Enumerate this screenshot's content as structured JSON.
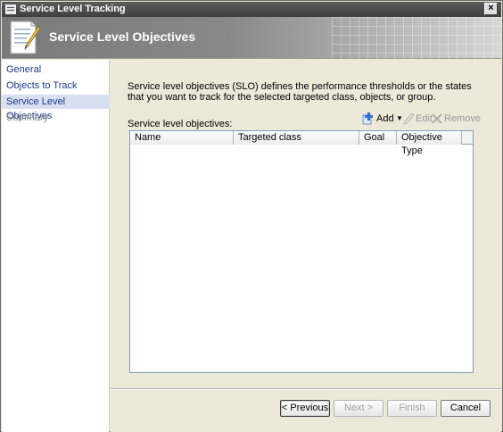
{
  "window": {
    "title": "Service Level Tracking",
    "close_label": "×"
  },
  "header": {
    "title": "Service Level Objectives"
  },
  "sidebar": {
    "items": [
      {
        "label": "General",
        "state": "normal"
      },
      {
        "label": "Objects to Track",
        "state": "normal"
      },
      {
        "label": "Service Level Objectives",
        "state": "active"
      },
      {
        "label": "Summary",
        "state": "disabled"
      }
    ]
  },
  "content": {
    "description": "Service level objectives (SLO) defines the performance thresholds or the states that you want to track for the selected targeted class, objects, or group.",
    "list_label": "Service level objectives:",
    "toolbar": {
      "add_label": "Add",
      "edit_label": "Edit",
      "remove_label": "Remove"
    },
    "columns": [
      "Name",
      "Targeted class",
      "Goal",
      "Objective Type"
    ],
    "rows": []
  },
  "footer": {
    "previous_label": "< Previous",
    "next_label": "Next >",
    "finish_label": "Finish",
    "cancel_label": "Cancel"
  },
  "colors": {
    "titlebar": "#4a4a4a",
    "nav_link": "#1c3a8a",
    "active_nav_bg": "#d7dff0"
  }
}
